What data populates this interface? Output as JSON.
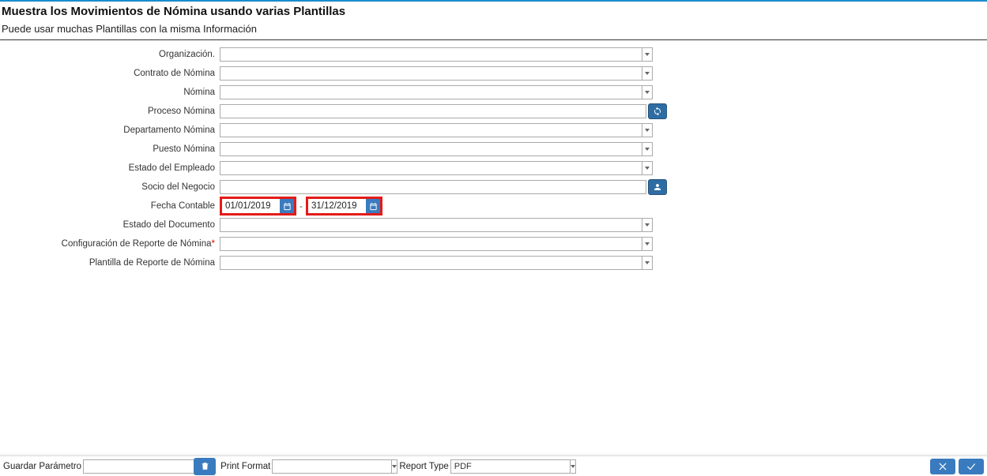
{
  "header": {
    "title": "Muestra los Movimientos de Nómina usando varias Plantillas",
    "subtitle": "Puede usar muchas Plantillas con la misma Información"
  },
  "form": {
    "organizacion": {
      "label": "Organización.",
      "value": ""
    },
    "contrato_nomina": {
      "label": "Contrato de Nómina",
      "value": ""
    },
    "nomina": {
      "label": "Nómina",
      "value": ""
    },
    "proceso_nomina": {
      "label": "Proceso Nómina",
      "value": ""
    },
    "departamento_nomina": {
      "label": "Departamento Nómina",
      "value": ""
    },
    "puesto_nomina": {
      "label": "Puesto Nómina",
      "value": ""
    },
    "estado_empleado": {
      "label": "Estado del Empleado",
      "value": ""
    },
    "socio_negocio": {
      "label": "Socio del Negocio",
      "value": ""
    },
    "fecha_contable": {
      "label": "Fecha Contable",
      "from": "01/01/2019",
      "to": "31/12/2019"
    },
    "estado_documento": {
      "label": "Estado del Documento",
      "value": ""
    },
    "config_reporte": {
      "label": "Configuración de Reporte de Nómina",
      "required": "*",
      "value": ""
    },
    "plantilla_reporte": {
      "label": "Plantilla de Reporte de Nómina",
      "value": ""
    }
  },
  "footer": {
    "guardar_label": "Guardar Parámetro",
    "guardar_value": "",
    "print_format_label": "Print Format",
    "print_format_value": "",
    "report_type_label": "Report Type",
    "report_type_value": "PDF"
  }
}
